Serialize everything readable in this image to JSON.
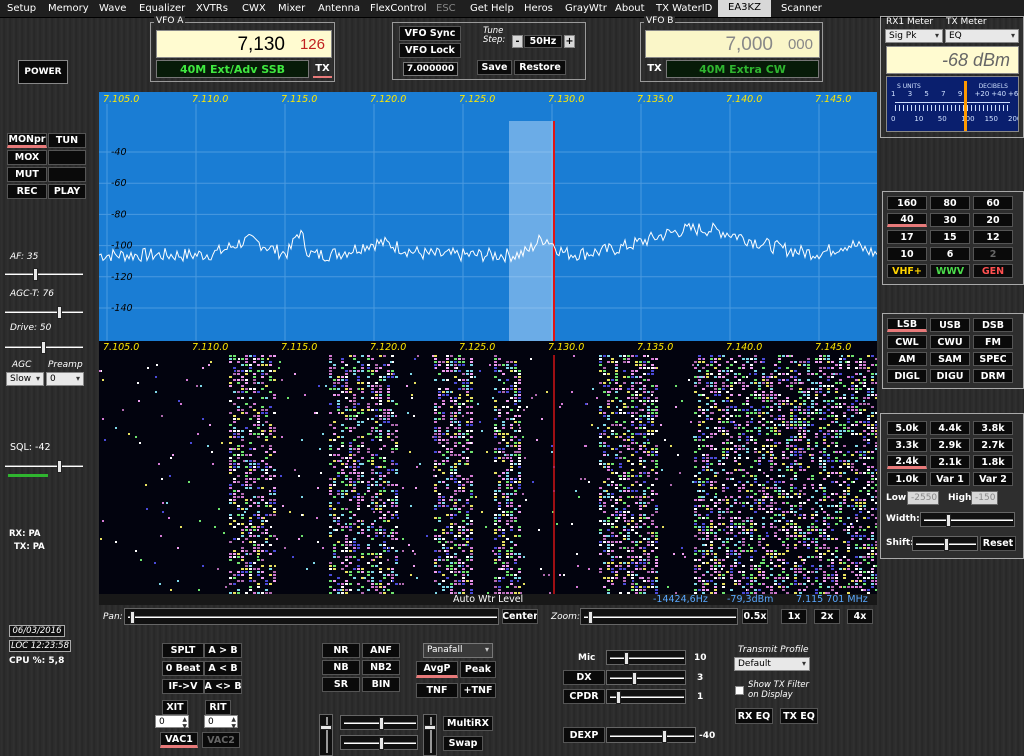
{
  "menu": {
    "items": [
      "Setup",
      "Memory",
      "Wave",
      "Equalizer",
      "XVTRs",
      "CWX",
      "Mixer",
      "Antenna",
      "FlexControl",
      "ESC",
      "Get Help",
      "Heros",
      "GrayWtr",
      "About",
      "TX WaterID",
      "EA3KZ",
      "Scanner"
    ]
  },
  "left": {
    "power_label": "POWER",
    "mon_label": "MONpr",
    "tun_label": "TUN",
    "mox_label": "MOX",
    "mut_label": "MUT",
    "rec_label": "REC",
    "play_label": "PLAY",
    "af_label": "AF: 35",
    "af_value": 35,
    "agct_label": "AGC-T: 76",
    "agct_value": 76,
    "drive_label": "Drive: 50",
    "drive_value": 50,
    "agc_label": "AGC",
    "agc_value": "Slow",
    "preamp_label": "Preamp",
    "preamp_value": "0",
    "sql_label": "SQL: -42",
    "rx_label": "RX: PA",
    "tx_label": "TX: PA",
    "date": "06/03/2016",
    "time": "LOC 12:23:58",
    "cpu": "CPU %: 5,8"
  },
  "vfoa": {
    "group_label": "VFO A",
    "freq_main": "7,130",
    "freq_sub": "126",
    "band": "40M Ext/Adv SSB",
    "tx_label": "TX"
  },
  "vfo_center": {
    "sync_label": "VFO Sync",
    "lock_label": "VFO Lock",
    "freq": "7.000000",
    "tune_step_label": "Tune Step:",
    "minus": "-",
    "plus": "+",
    "tune_step_value": "50Hz",
    "save_label": "Save",
    "restore_label": "Restore"
  },
  "vfob": {
    "group_label": "VFO B",
    "freq_main": "7,000",
    "freq_sub": "000",
    "tx_label": "TX",
    "band": "40M Extra CW"
  },
  "meter": {
    "rx1_label": "RX1 Meter",
    "tx_label": "TX Meter",
    "rx1_value": "Sig Pk",
    "tx_value": "EQ",
    "reading": "-68 dBm",
    "s_units": "S UNITS",
    "decibels": "DECIBELS",
    "scale_top": [
      "1",
      "3",
      "5",
      "7",
      "9",
      "+20",
      "+40",
      "+60"
    ],
    "scale_bottom": [
      "0",
      "10",
      "50",
      "100",
      "150",
      "200W"
    ],
    "needle_fraction": 0.59
  },
  "bands": [
    "160",
    "80",
    "60",
    "40",
    "30",
    "20",
    "17",
    "15",
    "12",
    "10",
    "6",
    "2",
    "VHF+",
    "WWV",
    "GEN"
  ],
  "modes": [
    "LSB",
    "USB",
    "DSB",
    "CWL",
    "CWU",
    "FM",
    "AM",
    "SAM",
    "SPEC",
    "DIGL",
    "DIGU",
    "DRM"
  ],
  "filters": {
    "items": [
      "5.0k",
      "4.4k",
      "3.8k",
      "3.3k",
      "2.9k",
      "2.7k",
      "2.4k",
      "2.1k",
      "1.8k",
      "1.0k",
      "Var 1",
      "Var 2"
    ],
    "low_label": "Low",
    "low_value": "-2550",
    "high_label": "High",
    "high_value": "-150",
    "width_label": "Width:",
    "shift_label": "Shift:",
    "reset_label": "Reset"
  },
  "display": {
    "freq_ticks": [
      "7.105.0",
      "7.110.0",
      "7.115.0",
      "7.120.0",
      "7.125.0",
      "7.130.0",
      "7.135.0",
      "7.140.0",
      "7.145.0"
    ],
    "db_ticks": [
      "-40",
      "-60",
      "-80",
      "-100",
      "-120",
      "-140"
    ],
    "auto_wtr_label": "Auto Wtr Level",
    "cursor_offset": "-14424,6Hz",
    "cursor_dbm": "-79,3dBm",
    "cursor_freq": "7.115 701 MHz",
    "pan_label": "Pan:",
    "center_label": "Center",
    "zoom_label": "Zoom:",
    "zoom_05": "0.5x",
    "zoom_1": "1x",
    "zoom_2": "2x",
    "zoom_4": "4x"
  },
  "bottom": {
    "splt": "SPLT",
    "atob": "A > B",
    "zerobeat": "0 Beat",
    "atoab": "A < B",
    "iftov": "IF->V",
    "aswapb": "A <> B",
    "xit": "XIT",
    "rit": "RIT",
    "xit_value": "0",
    "rit_value": "0",
    "vac1": "VAC1",
    "vac2": "VAC2",
    "nr": "NR",
    "anf": "ANF",
    "nb": "NB",
    "nb2": "NB2",
    "sr": "SR",
    "bin": "BIN",
    "display_mode": "Panafall",
    "avgp": "AvgP",
    "peak": "Peak",
    "tnf": "TNF",
    "ptnf": "+TNF",
    "multirx": "MultiRX",
    "swap": "Swap",
    "mic_label": "Mic",
    "mic_value": "10",
    "dx_label": "DX",
    "dx_value": "3",
    "cpdr_label": "CPDR",
    "cpdr_value": "1",
    "dexp_label": "DEXP",
    "dexp_value": "-40",
    "tx_profile_label": "Transmit Profile",
    "tx_profile_value": "Default",
    "show_tx_filter": "Show TX Filter on Display",
    "rx_eq": "RX EQ",
    "tx_eq": "TX EQ"
  },
  "colors": {
    "panadapter_bg": "#1a7dd4",
    "freq_tick": "#ffe800",
    "band_text": "#3fe83f",
    "vfo_bg": "#fffbd0",
    "filter_band": "#cfe6ff",
    "tx_cursor": "#e01515",
    "status_blue": "#5aa8ff"
  }
}
